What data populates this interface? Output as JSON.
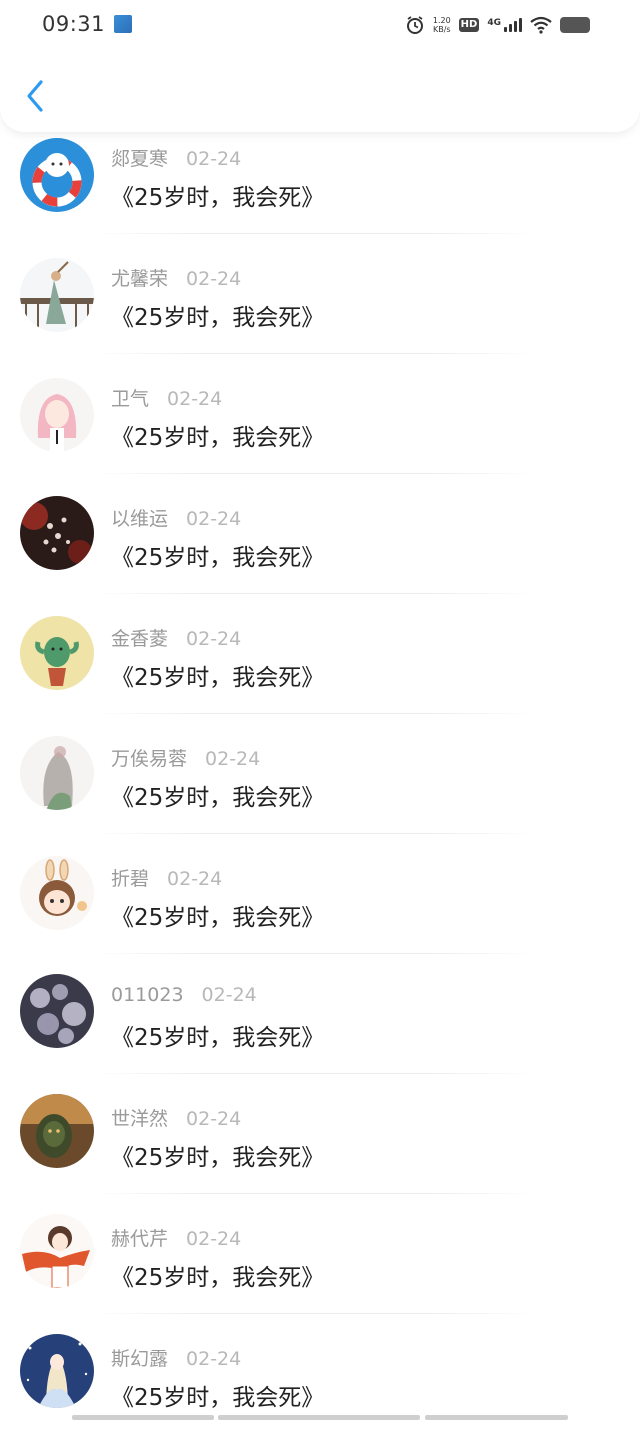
{
  "status": {
    "time": "09:31",
    "speed_value": "1.20",
    "speed_unit": "KB/s",
    "hd": "HD",
    "network": "4G"
  },
  "header": {
    "back_icon": "chevron-left-icon",
    "accent": "#2b9bf0"
  },
  "comments": [
    {
      "name": "郯夏寒",
      "date": "02-24",
      "title": "《25岁时，我会死》",
      "avatar": "lifebuoy-bear"
    },
    {
      "name": "尤馨荣",
      "date": "02-24",
      "title": "《25岁时，我会死》",
      "avatar": "girl-green-dress"
    },
    {
      "name": "卫气",
      "date": "02-24",
      "title": "《25岁时，我会死》",
      "avatar": "anime-girl-pink"
    },
    {
      "name": "以维运",
      "date": "02-24",
      "title": "《25岁时，我会死》",
      "avatar": "dark-blossoms"
    },
    {
      "name": "金香菱",
      "date": "02-24",
      "title": "《25岁时，我会死》",
      "avatar": "virgo-cactus"
    },
    {
      "name": "万俟易蓉",
      "date": "02-24",
      "title": "《25岁时，我会死》",
      "avatar": "girl-long-hair"
    },
    {
      "name": "折碧",
      "date": "02-24",
      "title": "《25岁时，我会死》",
      "avatar": "bunny-kid"
    },
    {
      "name": "011023",
      "date": "02-24",
      "title": "《25岁时，我会死》",
      "avatar": "night-flowers"
    },
    {
      "name": "世洋然",
      "date": "02-24",
      "title": "《25岁时，我会死》",
      "avatar": "orc-warrior"
    },
    {
      "name": "赫代芹",
      "date": "02-24",
      "title": "《25岁时，我会死》",
      "avatar": "girl-orange-scarf"
    },
    {
      "name": "斯幻露",
      "date": "02-24",
      "title": "《25岁时，我会死》",
      "avatar": "starry-princess"
    }
  ]
}
